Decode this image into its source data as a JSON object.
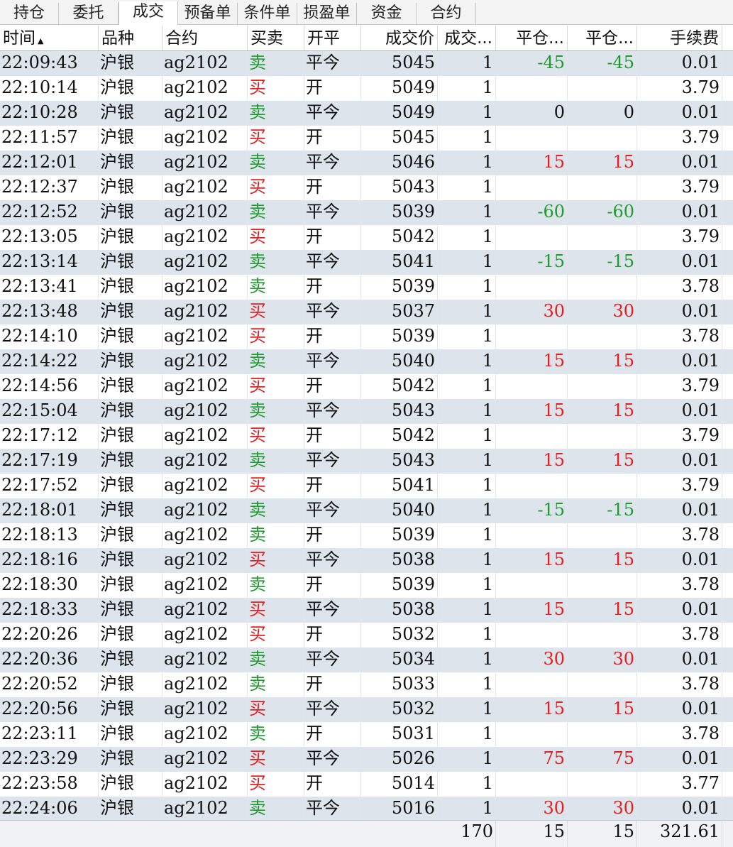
{
  "tabs": [
    "持仓",
    "委托",
    "成交",
    "预备单",
    "条件单",
    "损盈单",
    "资金",
    "合约"
  ],
  "active_tab": "成交",
  "columns": [
    "时间",
    "品种",
    "合约",
    "买卖",
    "开平",
    "成交价",
    "成交...",
    "平仓...",
    "平仓...",
    "手续费"
  ],
  "sort_indicator": "▲",
  "colors": {
    "buy": "#e61e1e",
    "sell": "#1f9a2e",
    "profit": "#e61e1e",
    "loss": "#1f9a2e",
    "alt_row": "#dde4ec"
  },
  "rows": [
    [
      "22:09:43",
      "沪银",
      "ag2102",
      "卖",
      "平今",
      "5045",
      "1",
      "-45",
      "-45",
      "0.01"
    ],
    [
      "22:10:14",
      "沪银",
      "ag2102",
      "买",
      "开",
      "5049",
      "1",
      "",
      "",
      "3.79"
    ],
    [
      "22:10:28",
      "沪银",
      "ag2102",
      "卖",
      "平今",
      "5049",
      "1",
      "0",
      "0",
      "0.01"
    ],
    [
      "22:11:57",
      "沪银",
      "ag2102",
      "买",
      "开",
      "5045",
      "1",
      "",
      "",
      "3.79"
    ],
    [
      "22:12:01",
      "沪银",
      "ag2102",
      "卖",
      "平今",
      "5046",
      "1",
      "15",
      "15",
      "0.01"
    ],
    [
      "22:12:37",
      "沪银",
      "ag2102",
      "买",
      "开",
      "5043",
      "1",
      "",
      "",
      "3.79"
    ],
    [
      "22:12:52",
      "沪银",
      "ag2102",
      "卖",
      "平今",
      "5039",
      "1",
      "-60",
      "-60",
      "0.01"
    ],
    [
      "22:13:05",
      "沪银",
      "ag2102",
      "买",
      "开",
      "5042",
      "1",
      "",
      "",
      "3.79"
    ],
    [
      "22:13:14",
      "沪银",
      "ag2102",
      "卖",
      "平今",
      "5041",
      "1",
      "-15",
      "-15",
      "0.01"
    ],
    [
      "22:13:41",
      "沪银",
      "ag2102",
      "卖",
      "开",
      "5039",
      "1",
      "",
      "",
      "3.78"
    ],
    [
      "22:13:48",
      "沪银",
      "ag2102",
      "买",
      "平今",
      "5037",
      "1",
      "30",
      "30",
      "0.01"
    ],
    [
      "22:14:10",
      "沪银",
      "ag2102",
      "买",
      "开",
      "5039",
      "1",
      "",
      "",
      "3.78"
    ],
    [
      "22:14:22",
      "沪银",
      "ag2102",
      "卖",
      "平今",
      "5040",
      "1",
      "15",
      "15",
      "0.01"
    ],
    [
      "22:14:56",
      "沪银",
      "ag2102",
      "买",
      "开",
      "5042",
      "1",
      "",
      "",
      "3.79"
    ],
    [
      "22:15:04",
      "沪银",
      "ag2102",
      "卖",
      "平今",
      "5043",
      "1",
      "15",
      "15",
      "0.01"
    ],
    [
      "22:17:12",
      "沪银",
      "ag2102",
      "买",
      "开",
      "5042",
      "1",
      "",
      "",
      "3.79"
    ],
    [
      "22:17:19",
      "沪银",
      "ag2102",
      "卖",
      "平今",
      "5043",
      "1",
      "15",
      "15",
      "0.01"
    ],
    [
      "22:17:52",
      "沪银",
      "ag2102",
      "买",
      "开",
      "5041",
      "1",
      "",
      "",
      "3.79"
    ],
    [
      "22:18:01",
      "沪银",
      "ag2102",
      "卖",
      "平今",
      "5040",
      "1",
      "-15",
      "-15",
      "0.01"
    ],
    [
      "22:18:13",
      "沪银",
      "ag2102",
      "卖",
      "开",
      "5039",
      "1",
      "",
      "",
      "3.78"
    ],
    [
      "22:18:16",
      "沪银",
      "ag2102",
      "买",
      "平今",
      "5038",
      "1",
      "15",
      "15",
      "0.01"
    ],
    [
      "22:18:30",
      "沪银",
      "ag2102",
      "卖",
      "开",
      "5039",
      "1",
      "",
      "",
      "3.78"
    ],
    [
      "22:18:33",
      "沪银",
      "ag2102",
      "买",
      "平今",
      "5038",
      "1",
      "15",
      "15",
      "0.01"
    ],
    [
      "22:20:26",
      "沪银",
      "ag2102",
      "买",
      "开",
      "5032",
      "1",
      "",
      "",
      "3.78"
    ],
    [
      "22:20:36",
      "沪银",
      "ag2102",
      "卖",
      "平今",
      "5034",
      "1",
      "30",
      "30",
      "0.01"
    ],
    [
      "22:20:52",
      "沪银",
      "ag2102",
      "卖",
      "开",
      "5033",
      "1",
      "",
      "",
      "3.78"
    ],
    [
      "22:20:56",
      "沪银",
      "ag2102",
      "买",
      "平今",
      "5032",
      "1",
      "15",
      "15",
      "0.01"
    ],
    [
      "22:23:11",
      "沪银",
      "ag2102",
      "卖",
      "开",
      "5031",
      "1",
      "",
      "",
      "3.78"
    ],
    [
      "22:23:29",
      "沪银",
      "ag2102",
      "买",
      "平今",
      "5026",
      "1",
      "75",
      "75",
      "0.01"
    ],
    [
      "22:23:58",
      "沪银",
      "ag2102",
      "买",
      "开",
      "5014",
      "1",
      "",
      "",
      "3.77"
    ],
    [
      "22:24:06",
      "沪银",
      "ag2102",
      "卖",
      "平今",
      "5016",
      "1",
      "30",
      "30",
      "0.01"
    ]
  ],
  "totals": {
    "volume": "170",
    "close_pnl_1": "15",
    "close_pnl_2": "15",
    "fee": "321.61"
  }
}
